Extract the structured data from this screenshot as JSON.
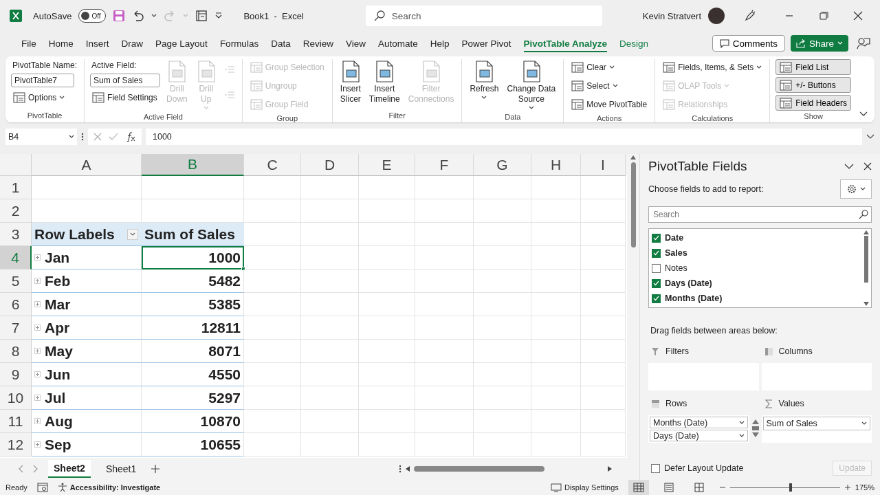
{
  "title_bar": {
    "autosave_label": "AutoSave",
    "autosave": {
      "on": false,
      "label": "Off"
    },
    "title": "Book1  -  Excel",
    "search": {
      "placeholder": "Search"
    },
    "user": "Kevin Stratvert"
  },
  "menu_tabs": [
    {
      "label": "File",
      "selected": false,
      "contextual": false
    },
    {
      "label": "Home",
      "selected": false,
      "contextual": false
    },
    {
      "label": "Insert",
      "selected": false,
      "contextual": false
    },
    {
      "label": "Draw",
      "selected": false,
      "contextual": false
    },
    {
      "label": "Page Layout",
      "selected": false,
      "contextual": false
    },
    {
      "label": "Formulas",
      "selected": false,
      "contextual": false
    },
    {
      "label": "Data",
      "selected": false,
      "contextual": false
    },
    {
      "label": "Review",
      "selected": false,
      "contextual": false
    },
    {
      "label": "View",
      "selected": false,
      "contextual": false
    },
    {
      "label": "Automate",
      "selected": false,
      "contextual": false
    },
    {
      "label": "Help",
      "selected": false,
      "contextual": false
    },
    {
      "label": "Power Pivot",
      "selected": false,
      "contextual": false
    },
    {
      "label": "PivotTable Analyze",
      "selected": true,
      "contextual": true
    },
    {
      "label": "Design",
      "selected": false,
      "contextual": true
    }
  ],
  "comments": "Comments",
  "share": "Share",
  "ribbon_groups": [
    {
      "label": "PivotTable",
      "columns": [
        [
          {
            "kind": "field",
            "label": "PivotTable Name:",
            "value": "PivotTable7"
          },
          {
            "kind": "small",
            "label": "Options",
            "disabled": false,
            "dropdown": true
          }
        ]
      ]
    },
    {
      "label": "Active Field",
      "columns": [
        [
          {
            "kind": "field",
            "label": "Active Field:",
            "value": "Sum of Sales"
          },
          {
            "kind": "small",
            "label": "Field Settings",
            "disabled": false,
            "dropdown": false
          }
        ],
        [
          {
            "kind": "large",
            "lines": [
              "Drill",
              "Down"
            ],
            "disabled": true,
            "dropdown": false
          }
        ],
        [
          {
            "kind": "large",
            "lines": [
              "Drill",
              "Up"
            ],
            "disabled": true,
            "dropdown": true
          }
        ],
        [
          {
            "kind": "icon",
            "disabled": true
          },
          {
            "kind": "icon",
            "disabled": true
          }
        ]
      ]
    },
    {
      "label": "Group",
      "columns": [
        [
          {
            "kind": "small",
            "label": "Group Selection",
            "disabled": true,
            "dropdown": false
          },
          {
            "kind": "small",
            "label": "Ungroup",
            "disabled": true,
            "dropdown": false
          },
          {
            "kind": "small",
            "label": "Group Field",
            "disabled": true,
            "dropdown": false
          }
        ]
      ]
    },
    {
      "label": "Filter",
      "columns": [
        [
          {
            "kind": "large",
            "lines": [
              "Insert",
              "Slicer"
            ],
            "disabled": false,
            "dropdown": false
          }
        ],
        [
          {
            "kind": "large",
            "lines": [
              "Insert",
              "Timeline"
            ],
            "disabled": false,
            "dropdown": false
          }
        ],
        [
          {
            "kind": "large",
            "lines": [
              "Filter",
              "Connections"
            ],
            "disabled": true,
            "dropdown": false
          }
        ]
      ]
    },
    {
      "label": "Data",
      "columns": [
        [
          {
            "kind": "large",
            "lines": [
              "Refresh"
            ],
            "disabled": false,
            "dropdown": true
          }
        ],
        [
          {
            "kind": "large",
            "lines": [
              "Change Data",
              "Source"
            ],
            "disabled": false,
            "dropdown": true
          }
        ]
      ]
    },
    {
      "label": "Actions",
      "columns": [
        [
          {
            "kind": "small",
            "label": "Clear",
            "disabled": false,
            "dropdown": true
          },
          {
            "kind": "small",
            "label": "Select",
            "disabled": false,
            "dropdown": true
          },
          {
            "kind": "small",
            "label": "Move PivotTable",
            "disabled": false,
            "dropdown": false
          }
        ]
      ]
    },
    {
      "label": "Calculations",
      "columns": [
        [
          {
            "kind": "small",
            "label": "Fields, Items, & Sets",
            "disabled": false,
            "dropdown": true
          },
          {
            "kind": "small",
            "label": "OLAP Tools",
            "disabled": true,
            "dropdown": true
          },
          {
            "kind": "small",
            "label": "Relationships",
            "disabled": true,
            "dropdown": false
          }
        ]
      ]
    },
    {
      "label": "Show",
      "columns": [
        [
          {
            "kind": "toggle",
            "label": "Field List",
            "selected": true
          },
          {
            "kind": "toggle",
            "label": "+/- Buttons",
            "selected": true
          },
          {
            "kind": "toggle",
            "label": "Field Headers",
            "selected": true
          }
        ]
      ]
    }
  ],
  "formula_bar": {
    "name_box": "B4",
    "formula": "1000"
  },
  "sheet": {
    "columns": [
      {
        "label": "A",
        "selected": false
      },
      {
        "label": "B",
        "selected": true
      },
      {
        "label": "C",
        "selected": false
      },
      {
        "label": "D",
        "selected": false
      },
      {
        "label": "E",
        "selected": false
      },
      {
        "label": "F",
        "selected": false
      },
      {
        "label": "G",
        "selected": false
      },
      {
        "label": "H",
        "selected": false
      },
      {
        "label": "I",
        "selected": false
      }
    ],
    "rows": [
      {
        "number": "1",
        "kind": "blank",
        "selected": false
      },
      {
        "number": "2",
        "kind": "blank",
        "selected": false
      },
      {
        "number": "3",
        "kind": "header",
        "selected": false,
        "label": "Row Labels",
        "value": "Sum of Sales"
      },
      {
        "number": "4",
        "kind": "data",
        "selected": true,
        "label": "Jan",
        "value": "1000"
      },
      {
        "number": "5",
        "kind": "data",
        "selected": false,
        "label": "Feb",
        "value": "5482"
      },
      {
        "number": "6",
        "kind": "data",
        "selected": false,
        "label": "Mar",
        "value": "5385"
      },
      {
        "number": "7",
        "kind": "data",
        "selected": false,
        "label": "Apr",
        "value": "12811"
      },
      {
        "number": "8",
        "kind": "data",
        "selected": false,
        "label": "May",
        "value": "8071"
      },
      {
        "number": "9",
        "kind": "data",
        "selected": false,
        "label": "Jun",
        "value": "4550"
      },
      {
        "number": "10",
        "kind": "data",
        "selected": false,
        "label": "Jul",
        "value": "5297"
      },
      {
        "number": "11",
        "kind": "data",
        "selected": false,
        "label": "Aug",
        "value": "10870"
      },
      {
        "number": "12",
        "kind": "data",
        "selected": false,
        "label": "Sep",
        "value": "10655"
      }
    ]
  },
  "sheet_tabs": [
    {
      "label": "Sheet2",
      "selected": true
    },
    {
      "label": "Sheet1",
      "selected": false
    }
  ],
  "pivot_pane": {
    "title": "PivotTable Fields",
    "prompt": "Choose fields to add to report:",
    "search": {
      "placeholder": "Search"
    },
    "fields": [
      {
        "label": "Date",
        "checked": true
      },
      {
        "label": "Sales",
        "checked": true
      },
      {
        "label": "Notes",
        "checked": false
      },
      {
        "label": "Days (Date)",
        "checked": true
      },
      {
        "label": "Months (Date)",
        "checked": true
      }
    ],
    "areas_prompt": "Drag fields between areas below:",
    "areas": [
      {
        "kind": "filters",
        "label": "Filters"
      },
      {
        "kind": "columns",
        "label": "Columns"
      },
      {
        "kind": "rows",
        "label": "Rows",
        "items": [
          "Months (Date)",
          "Days (Date)"
        ]
      },
      {
        "kind": "values",
        "label": "Values",
        "items": [
          "Sum of Sales"
        ]
      }
    ],
    "defer": {
      "label": "Defer Layout Update",
      "checked": false
    },
    "update": {
      "label": "Update",
      "disabled": true
    }
  },
  "status_bar": {
    "mode": "Ready",
    "accessibility": "Accessibility: Investigate",
    "display_settings": "Display Settings",
    "views": [
      {
        "kind": "normal",
        "selected": true
      },
      {
        "kind": "page_layout",
        "selected": false
      },
      {
        "kind": "page_break",
        "selected": false
      }
    ],
    "zoom": {
      "level": 0.55,
      "label": "175%"
    }
  }
}
